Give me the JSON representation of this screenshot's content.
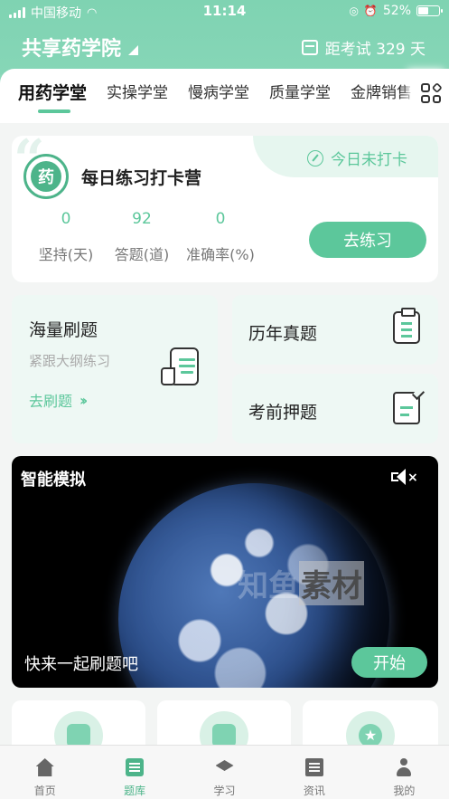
{
  "status_bar": {
    "carrier": "中国移动",
    "time": "11:14",
    "battery": "52%",
    "battery_level": 0.52
  },
  "header": {
    "brand": "共享药学院",
    "exam_countdown": "距考试 329 天"
  },
  "tabs": [
    {
      "label": "用药学堂",
      "active": true
    },
    {
      "label": "实操学堂",
      "active": false
    },
    {
      "label": "慢病学堂",
      "active": false
    },
    {
      "label": "质量学堂",
      "active": false
    },
    {
      "label": "金牌销售",
      "active": false
    }
  ],
  "checkin": {
    "logo_char": "药",
    "title": "每日练习打卡营",
    "status": "今日未打卡",
    "stats": [
      {
        "value": "0",
        "label": "坚持(天)"
      },
      {
        "value": "92",
        "label": "答题(道)"
      },
      {
        "value": "0",
        "label": "准确率(%)"
      }
    ],
    "button": "去练习"
  },
  "modes": {
    "sea": {
      "title": "海量刷题",
      "subtitle": "紧跟大纲练习",
      "link": "去刷题",
      "icon": "scroll-icon"
    },
    "years": {
      "title": "历年真题",
      "icon": "clipboard-icon"
    },
    "pre": {
      "title": "考前押题",
      "icon": "check-paper-icon"
    }
  },
  "video": {
    "title": "智能模拟",
    "watermark_a": "知鱼",
    "watermark_b": "素材",
    "caption": "快来一起刷题吧",
    "button": "开始",
    "mute_icon": "mute-icon"
  },
  "tab_bar": [
    {
      "label": "首页",
      "icon": "home-icon",
      "active": false
    },
    {
      "label": "题库",
      "icon": "question-bank-icon",
      "active": true
    },
    {
      "label": "学习",
      "icon": "graduation-cap-icon",
      "active": false
    },
    {
      "label": "资讯",
      "icon": "news-icon",
      "active": false
    },
    {
      "label": "我的",
      "icon": "profile-icon",
      "active": false
    }
  ],
  "colors": {
    "accent": "#5cc79b",
    "header": "#7fd3b2"
  }
}
